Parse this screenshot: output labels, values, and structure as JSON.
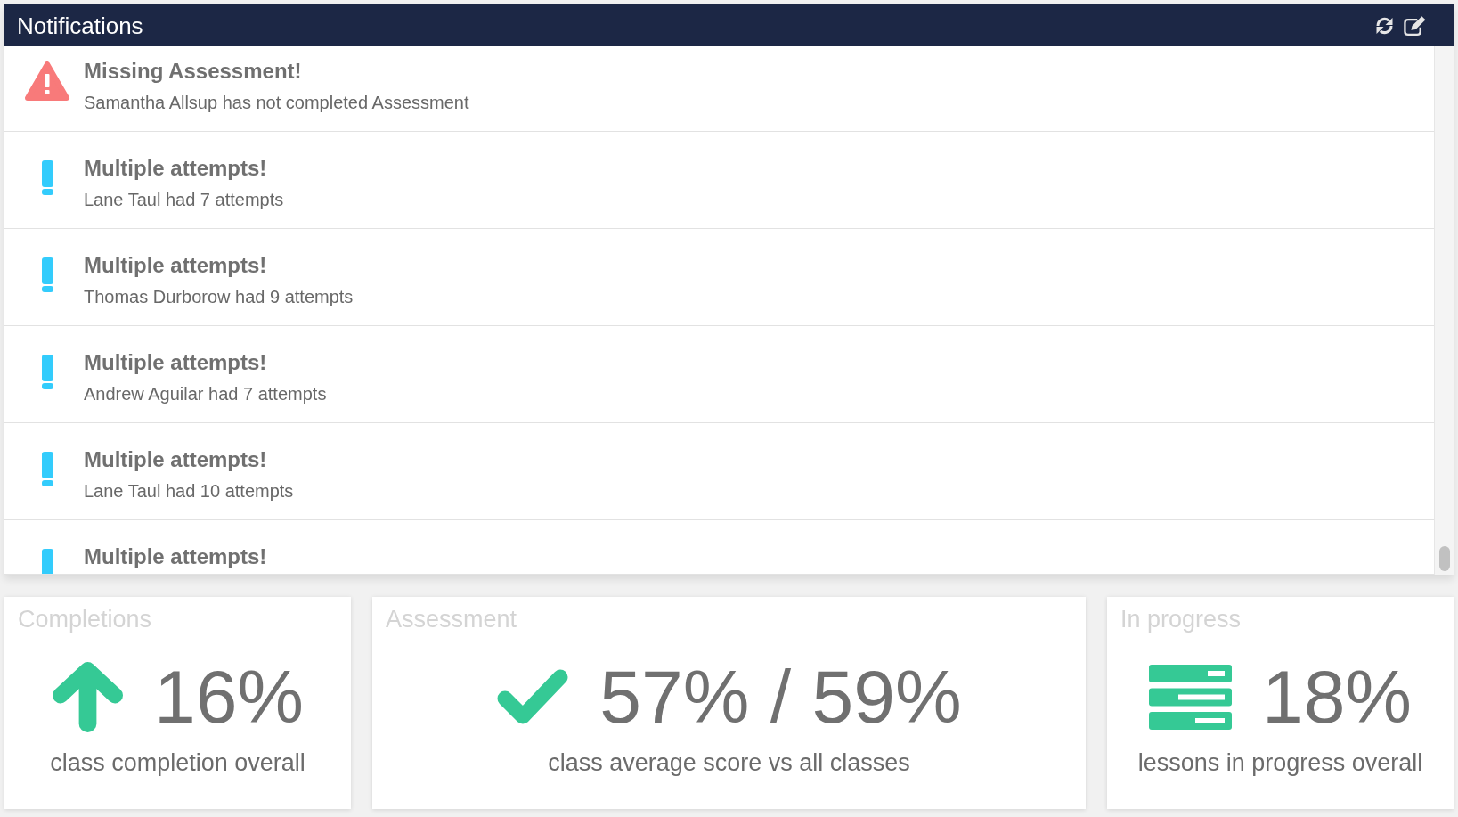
{
  "panel": {
    "title": "Notifications"
  },
  "notifications": [
    {
      "kind": "missing",
      "title": "Missing Assessment!",
      "message": "Samantha Allsup has not completed Assessment"
    },
    {
      "kind": "attempts",
      "title": "Multiple attempts!",
      "message": "Lane Taul had 7 attempts"
    },
    {
      "kind": "attempts",
      "title": "Multiple attempts!",
      "message": "Thomas Durborow had 9 attempts"
    },
    {
      "kind": "attempts",
      "title": "Multiple attempts!",
      "message": "Andrew Aguilar had 7 attempts"
    },
    {
      "kind": "attempts",
      "title": "Multiple attempts!",
      "message": "Lane Taul had 10 attempts"
    },
    {
      "kind": "attempts",
      "title": "Multiple attempts!"
    }
  ],
  "stats": [
    {
      "kind": "completion",
      "title": "Completions",
      "value": "16%",
      "caption": "class completion overall"
    },
    {
      "kind": "assessment",
      "title": "Assessment",
      "value": "57% / 59%",
      "caption": "class average score vs all classes"
    },
    {
      "kind": "progress",
      "title": "In progress",
      "value": "18%",
      "caption": "lessons in progress overall"
    }
  ]
}
